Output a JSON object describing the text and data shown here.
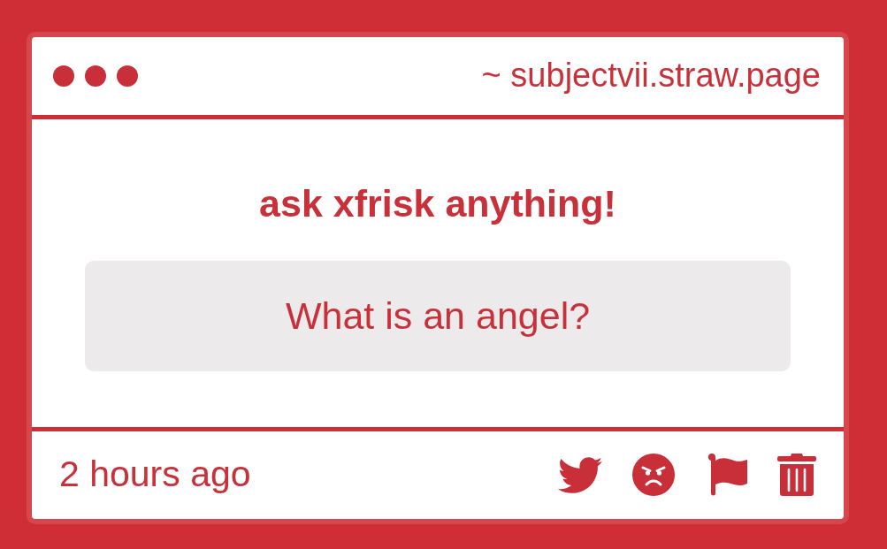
{
  "header": {
    "address": "~ subjectvii.straw.page"
  },
  "prompt": {
    "title": "ask xfrisk anything!",
    "question": "What is an angel?"
  },
  "footer": {
    "time": "2 hours ago"
  }
}
